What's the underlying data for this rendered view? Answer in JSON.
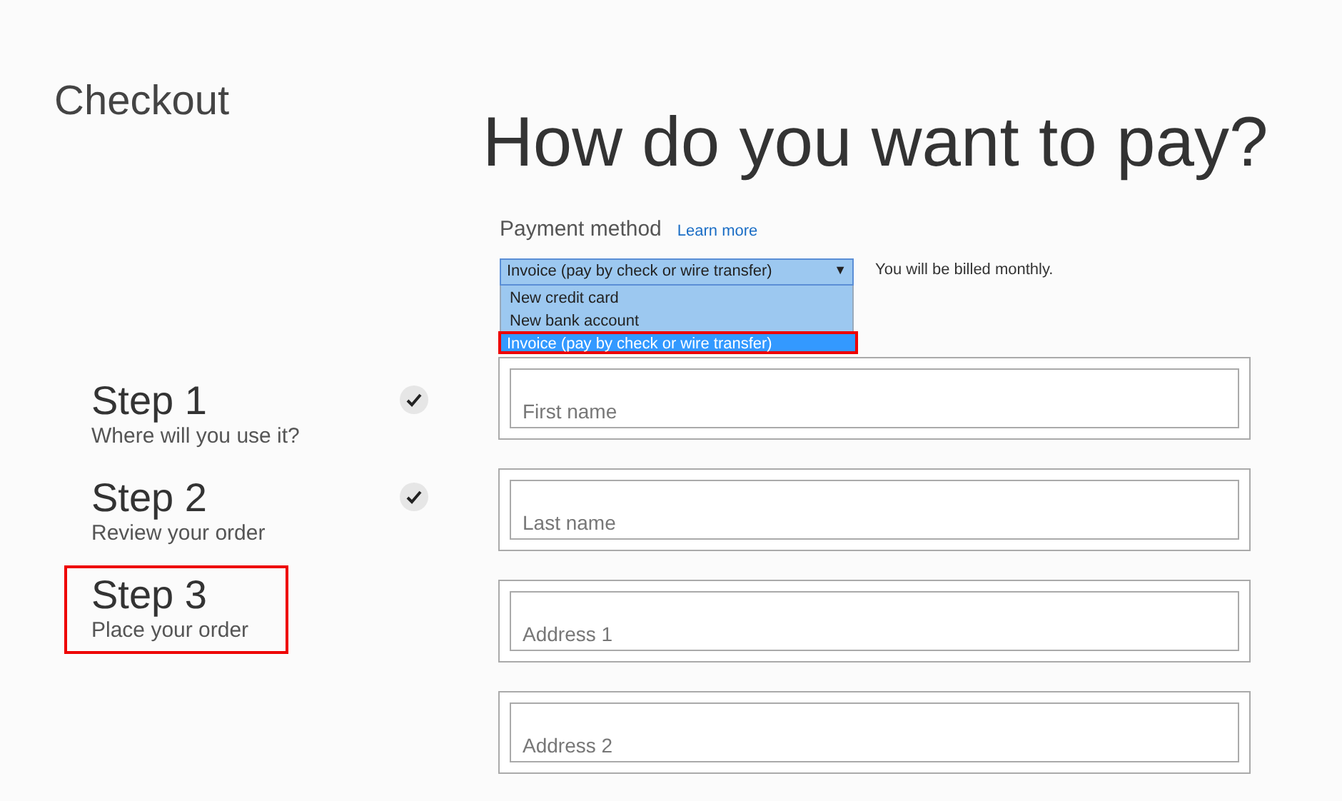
{
  "page_title": "Checkout",
  "steps": [
    {
      "title": "Step 1",
      "subtitle": "Where will you use it?",
      "done": true,
      "highlighted": false
    },
    {
      "title": "Step 2",
      "subtitle": "Review your order",
      "done": true,
      "highlighted": false
    },
    {
      "title": "Step 3",
      "subtitle": "Place your order",
      "done": false,
      "highlighted": true
    }
  ],
  "heading": "How do you want to pay?",
  "payment": {
    "label": "Payment method",
    "link": "Learn more",
    "value": "Invoice (pay by check or wire transfer)",
    "caret": "▼",
    "note": "You will be billed monthly.",
    "expanded": true,
    "options": [
      {
        "label": "New credit card",
        "selected": false,
        "highlighted": false
      },
      {
        "label": "New bank account",
        "selected": false,
        "highlighted": false
      },
      {
        "label": "Invoice (pay by check or wire transfer)",
        "selected": true,
        "highlighted": true
      }
    ]
  },
  "fields": [
    {
      "placeholder": "First name"
    },
    {
      "placeholder": "Last name"
    },
    {
      "placeholder": "Address 1"
    },
    {
      "placeholder": "Address 2"
    }
  ]
}
